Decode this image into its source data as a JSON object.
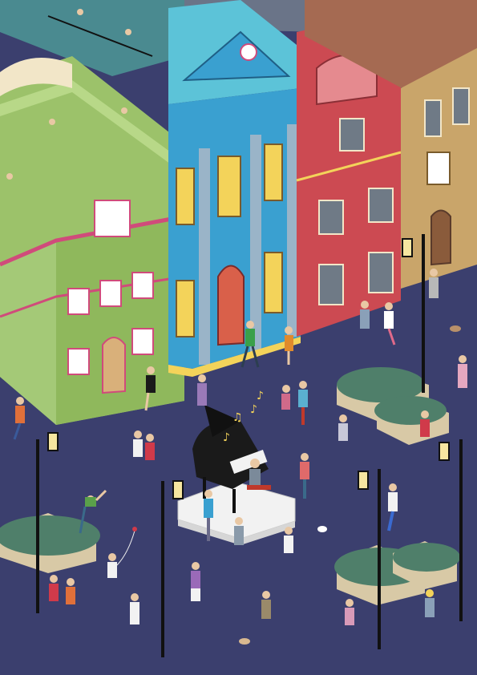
{
  "scene": {
    "colors": {
      "plaza": "#3b3f6e",
      "sky": "#6a7488",
      "green_building": "#9cc26a",
      "green_trim": "#d04b7b",
      "blue_building": "#3aa0d0",
      "blue_roof": "#5cc3d8",
      "red_building": "#cc4a52",
      "red_trim": "#e58a8f",
      "tan_building": "#c9a56a",
      "window_lit": "#f3d35a",
      "piano": "#1a1a1a",
      "stage": "#f2f2f2",
      "hedge": "#4f7f6a",
      "planter": "#d8c9a6",
      "lamp": "#111111",
      "lamp_glow": "#f6e6a0"
    }
  }
}
